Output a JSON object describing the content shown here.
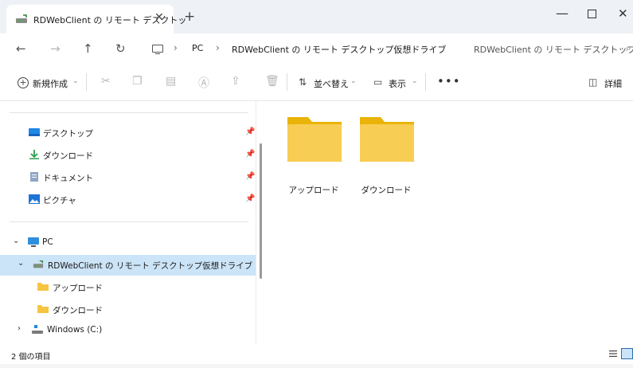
{
  "tab": {
    "title": "RDWebClient の リモート デスクトッ",
    "close": "✕",
    "new": "+"
  },
  "window": {
    "minimize": "—",
    "close": "✕"
  },
  "nav": {
    "back": "←",
    "forward": "→",
    "up": "↑",
    "refresh": "↻"
  },
  "breadcrumb": {
    "sep1": "›",
    "pc": "PC",
    "sep2": "›",
    "drive": "RDWebClient の リモート デスクトップ仮想ドライブ",
    "sep3": "›"
  },
  "search": {
    "placeholder": "RDWebClient の リモート デスクトップ",
    "icon": "⌕"
  },
  "toolbar": {
    "new_label": "新規作成",
    "sort_label": "並べ替え",
    "view_label": "表示",
    "more": "•••",
    "details_label": "詳細",
    "caret": "⌄"
  },
  "sidebar": {
    "quick": [
      {
        "label": "デスクトップ",
        "icon": "desktop-icon"
      },
      {
        "label": "ダウンロード",
        "icon": "download-icon"
      },
      {
        "label": "ドキュメント",
        "icon": "document-icon"
      },
      {
        "label": "ピクチャ",
        "icon": "pictures-icon"
      }
    ],
    "pin": "📌",
    "tree": {
      "pc": "PC",
      "drive": "RDWebClient の リモート デスクトップ仮想ドライブ",
      "upload": "アップロード",
      "download": "ダウンロード",
      "windows": "Windows (C:)"
    }
  },
  "content": {
    "folders": [
      {
        "name": "アップロード"
      },
      {
        "name": "ダウンロード"
      }
    ]
  },
  "status": {
    "count": "2 個の項目"
  },
  "colors": {
    "folder": "#f5c542",
    "folder_back": "#eab308",
    "selected": "#cce4f7",
    "accent": "#2b6cb0"
  }
}
